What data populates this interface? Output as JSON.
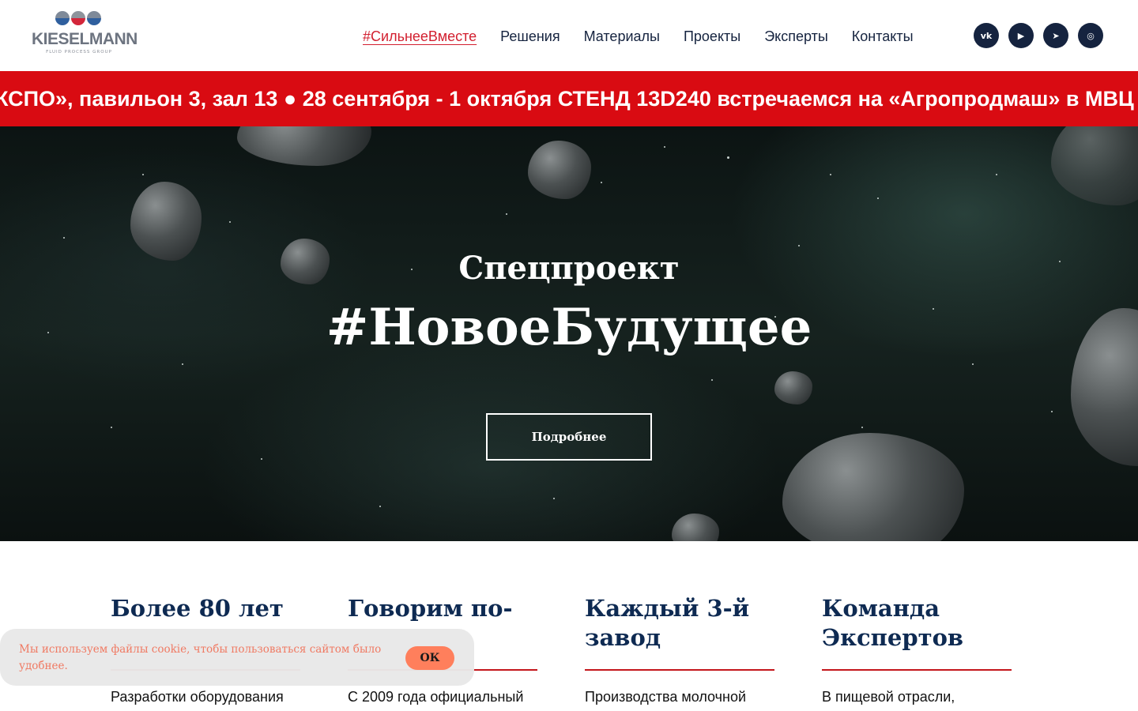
{
  "header": {
    "logo": {
      "name": "KIESELMANN",
      "tagline": "FLUID PROCESS GROUP"
    },
    "nav": [
      {
        "label": "#СильнееВместе",
        "active": true
      },
      {
        "label": "Решения"
      },
      {
        "label": "Материалы"
      },
      {
        "label": "Проекты"
      },
      {
        "label": "Эксперты"
      },
      {
        "label": "Контакты"
      }
    ],
    "socials": [
      {
        "icon": "vk-icon",
        "glyph": "vk"
      },
      {
        "icon": "youtube-icon",
        "glyph": "▶"
      },
      {
        "icon": "telegram-icon",
        "glyph": "➤"
      },
      {
        "icon": "chat-icon",
        "glyph": "◎"
      }
    ]
  },
  "ticker": {
    "text": "КСПО», павильон 3, зал 13 ● 28 сентября - 1 октября СТЕНД 13D240 встречаемся на «Агропродмаш» в МВЦ",
    "background": "#d90b12"
  },
  "hero": {
    "subtitle": "Спецпроект",
    "title": "#НовоеБудущее",
    "button": "Подробнее"
  },
  "features": [
    {
      "title": "Более 80 лет",
      "text": "Разработки оборудования"
    },
    {
      "title": "Говорим по-",
      "text": "С 2009 года официальный"
    },
    {
      "title": "Каждый 3-й завод",
      "text": "Производства молочной"
    },
    {
      "title": "Команда Экспертов",
      "text": "В пищевой отрасли,"
    }
  ],
  "cookie": {
    "text": "Мы используем файлы cookie, чтобы пользоваться сайтом было удобнее.",
    "button": "ОК"
  },
  "colors": {
    "accent": "#d21f2f",
    "navy": "#15233f",
    "heading": "#0e2a52",
    "cookie_button": "#ff7f5c"
  }
}
